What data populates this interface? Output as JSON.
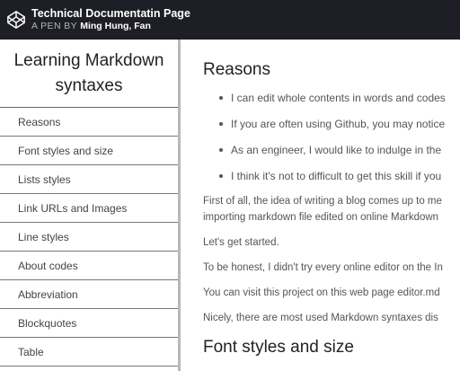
{
  "header": {
    "pen_title": "Technical Documentatin Page",
    "pen_byline": "A PEN BY",
    "pen_author": "Ming Hung, Fan",
    "logo_icon": "codepen-logo-icon"
  },
  "sidebar": {
    "title": "Learning Markdown syntaxes",
    "items": [
      {
        "label": "Reasons"
      },
      {
        "label": "Font styles and size"
      },
      {
        "label": "Lists styles"
      },
      {
        "label": "Link URLs and Images"
      },
      {
        "label": "Line styles"
      },
      {
        "label": "About codes"
      },
      {
        "label": "Abbreviation"
      },
      {
        "label": "Blockquotes"
      },
      {
        "label": "Table"
      }
    ]
  },
  "main": {
    "reasons": {
      "title": "Reasons",
      "bullets": [
        "I can edit whole contents in words and codes",
        "If you are often using Github, you may notice",
        "As an engineer, I would like to indulge in the",
        "I think it's not to difficult to get this skill if you"
      ],
      "paragraphs": [
        "First of all, the idea of writing a blog comes up to me",
        "importing markdown file edited on online Markdown",
        "Let's get started.",
        "To be honest, I didn't try every online editor on the In",
        "You can visit this project on this web page editor.md",
        "Nicely, there are most used Markdown syntaxes dis"
      ]
    },
    "font_styles": {
      "title": "Font styles and size"
    }
  }
}
